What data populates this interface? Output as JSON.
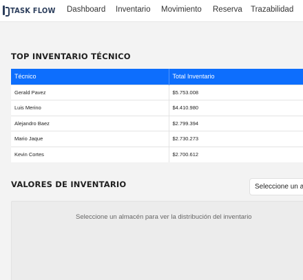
{
  "brand": {
    "name": "TASK FLOW"
  },
  "nav": {
    "items": [
      {
        "label": "Dashboard"
      },
      {
        "label": "Inventario"
      },
      {
        "label": "Movimiento"
      },
      {
        "label": "Reserva"
      },
      {
        "label": "Trazabilidad"
      }
    ]
  },
  "top_inventory": {
    "title": "TOP INVENTARIO TÉCNICO",
    "columns": [
      "Técnico",
      "Total Inventario"
    ],
    "rows": [
      {
        "name": "Gerald Pavez",
        "total": "$5.753.008"
      },
      {
        "name": "Luis Merino",
        "total": "$4.410.980"
      },
      {
        "name": "Alejandro Baez",
        "total": "$2.799.394"
      },
      {
        "name": "Mario Jaque",
        "total": "$2.730.273"
      },
      {
        "name": "Kevin Cortes",
        "total": "$2.700.612"
      }
    ]
  },
  "inventory_values": {
    "title": "VALORES DE INVENTARIO",
    "select_value": "Seleccione un almacén",
    "empty_message": "Seleccione un almacén para ver la distribución del inventario"
  }
}
